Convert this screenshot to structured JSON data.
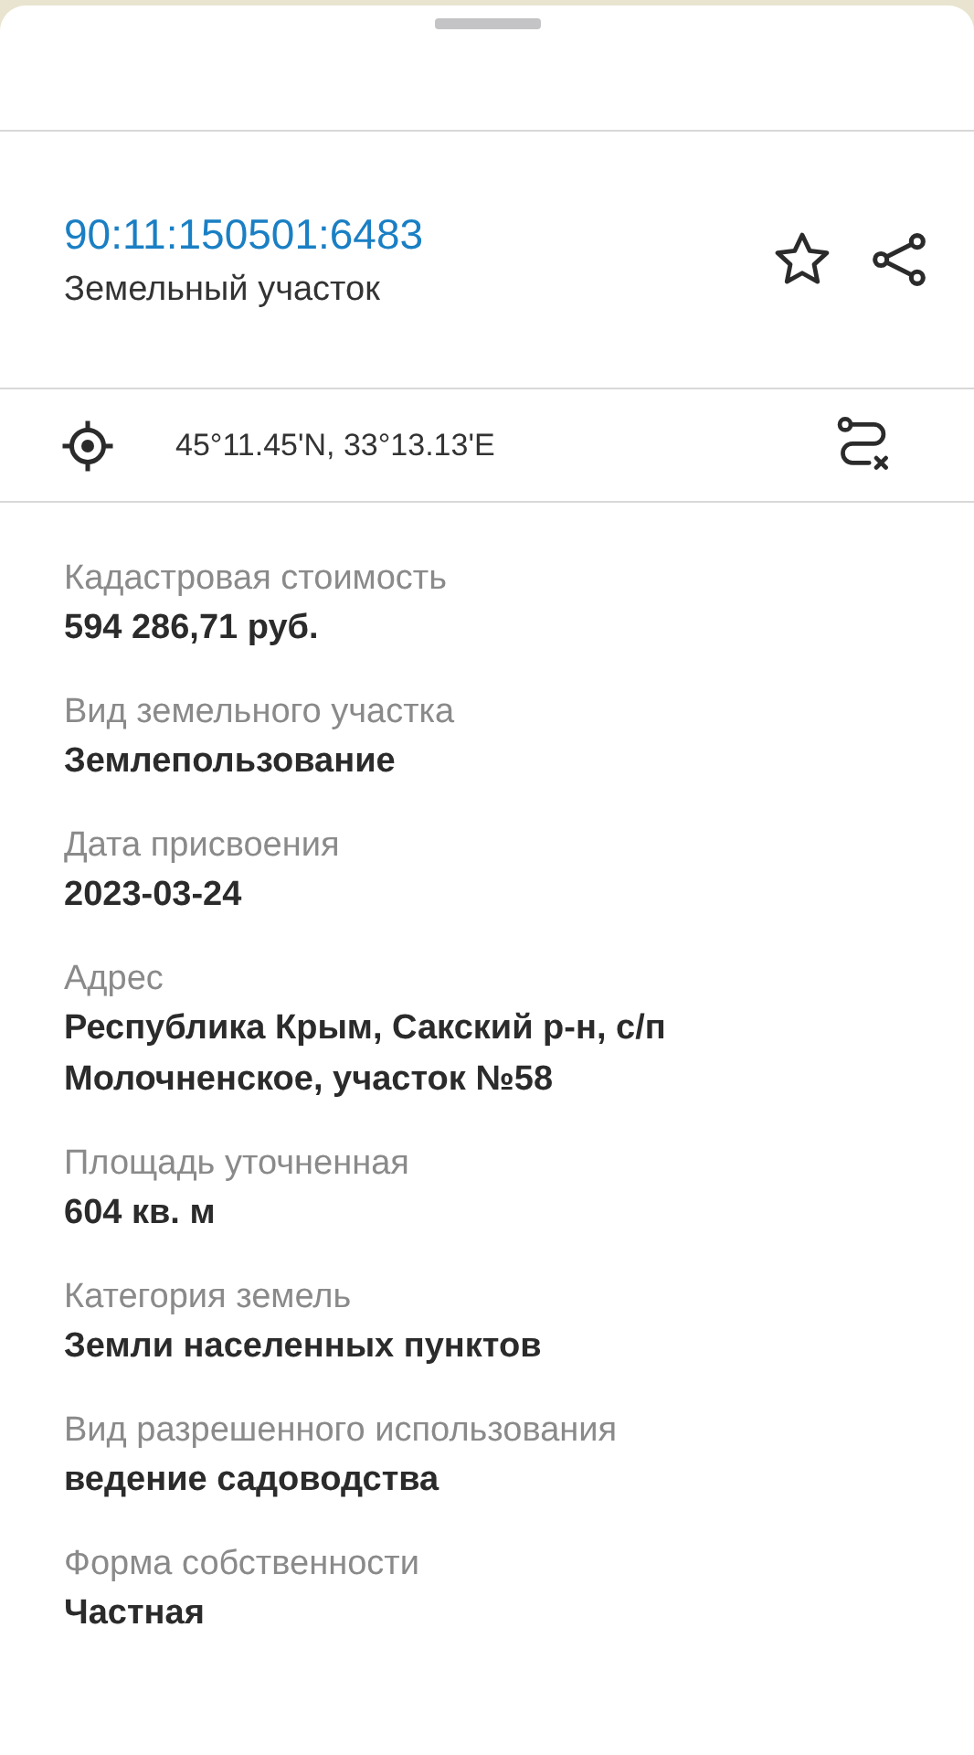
{
  "header": {
    "cadastral_number": "90:11:150501:6483",
    "subtitle": "Земельный участок"
  },
  "location": {
    "coordinates": "45°11.45'N, 33°13.13'E"
  },
  "fields": [
    {
      "label": "Кадастровая стоимость",
      "value": "594 286,71 руб."
    },
    {
      "label": "Вид земельного участка",
      "value": "Землепользование"
    },
    {
      "label": "Дата присвоения",
      "value": "2023-03-24"
    },
    {
      "label": "Адрес",
      "value": "Республика Крым, Сакский р-н, с/п Молочненское, участок №58"
    },
    {
      "label": "Площадь уточненная",
      "value": "604 кв. м"
    },
    {
      "label": "Категория земель",
      "value": "Земли населенных пунктов"
    },
    {
      "label": "Вид разрешенного использования",
      "value": "ведение садоводства"
    },
    {
      "label": "Форма собственности",
      "value": "Частная"
    }
  ]
}
